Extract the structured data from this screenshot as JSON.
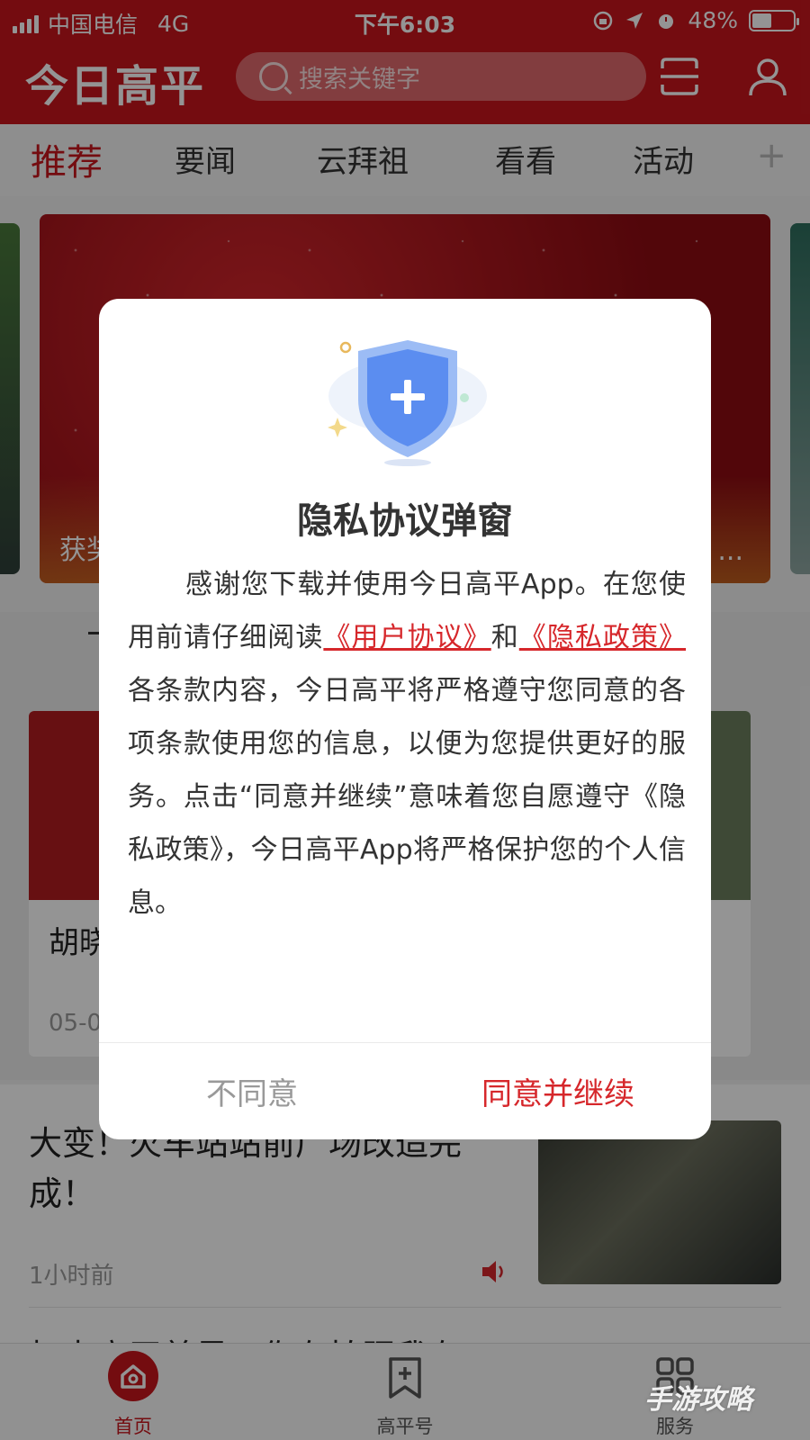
{
  "status_bar": {
    "carrier": "中国电信",
    "network": "4G",
    "time": "下午6:03",
    "battery": "48%",
    "battery_level": 0.48
  },
  "header": {
    "app_title": "今日高平",
    "search_placeholder": "搜索关键字"
  },
  "tabs": [
    {
      "label": "推荐",
      "active": true
    },
    {
      "label": "要闻"
    },
    {
      "label": "云拜祖"
    },
    {
      "label": "看看"
    },
    {
      "label": "活动"
    }
  ],
  "tab_add": "+",
  "banner": {
    "caption_left": "获奖",
    "caption_right": "..."
  },
  "feed": {
    "card_title": "胡晓",
    "card_date": "05-0",
    "news1_title": "大变！火车站站前广场改造完成！",
    "news1_time": "1小时前",
    "news2_title": "打卡高平美景！你在拍照我在"
  },
  "modal": {
    "title": "隐私协议弹窗",
    "body_1": "感谢您下载并使用今日高平App。在您使用前请仔细阅读",
    "link_user": "《用户协议》",
    "body_and": "和",
    "link_privacy": "《隐私政策》",
    "body_2": "各条款内容，今日高平将严格遵守您同意的各项条款使用您的信息，以便为您提供更好的服务。点击“同意并继续”意味着您自愿遵守《隐私政策》，今日高平App将严格保护您的个人信息。",
    "disagree_label": "不同意",
    "agree_label": "同意并继续"
  },
  "bottom_nav": [
    {
      "label": "首页",
      "active": true
    },
    {
      "label": "高平号"
    },
    {
      "label": "服务"
    }
  ],
  "watermark": "手游攻略",
  "colors": {
    "brand_red": "#c8161d",
    "link_red": "#d6272b",
    "shield_blue": "#5b8df0"
  }
}
